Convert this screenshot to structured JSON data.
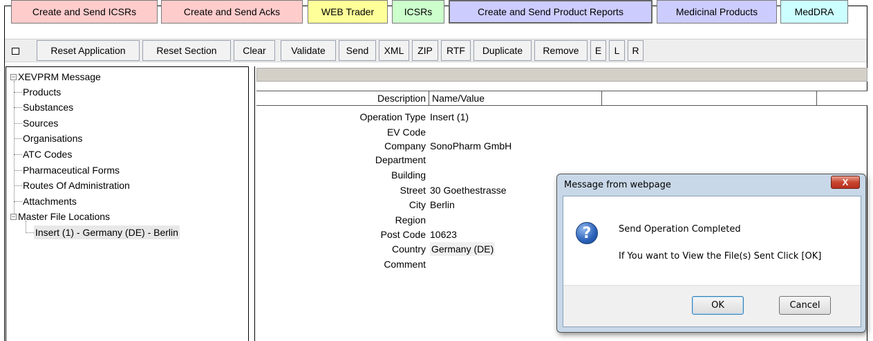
{
  "tabs": [
    {
      "label": "Create and Send ICSRs",
      "color": "#ffcccc"
    },
    {
      "label": "Create and Send Acks",
      "color": "#ffcccc"
    },
    {
      "label": "WEB Trader",
      "color": "#ffff99"
    },
    {
      "label": "ICSRs",
      "color": "#ccffcc"
    },
    {
      "label": "Create and Send Product Reports",
      "color": "#ccccff"
    },
    {
      "label": "Medicinal Products",
      "color": "#ccccff"
    },
    {
      "label": "MedDRA",
      "color": "#ccffff"
    }
  ],
  "toolbar": {
    "reset_application": "Reset Application",
    "reset_section": "Reset Section",
    "clear": "Clear",
    "validate": "Validate",
    "send": "Send",
    "xml": "XML",
    "zip": "ZIP",
    "rtf": "RTF",
    "duplicate": "Duplicate",
    "remove": "Remove",
    "e": "E",
    "l": "L",
    "r": "R"
  },
  "tree": {
    "root": "XEVPRM Message",
    "items": [
      "Products",
      "Substances",
      "Sources",
      "Organisations",
      "ATC Codes",
      "Pharmaceutical Forms",
      "Routes Of Administration",
      "Attachments"
    ],
    "master": "Master File Locations",
    "child": "Insert (1) - Germany (DE) - Berlin"
  },
  "grid": {
    "headers": [
      "Description",
      "Name/Value"
    ],
    "rows": [
      {
        "label": "Operation Type",
        "value": "Insert (1)"
      },
      {
        "label": "EV Code",
        "value": ""
      },
      {
        "label": "Company",
        "value": "SonoPharm GmbH"
      },
      {
        "label": "Department",
        "value": ""
      },
      {
        "label": "Building",
        "value": ""
      },
      {
        "label": "Street",
        "value": "30 Goethestrasse"
      },
      {
        "label": "City",
        "value": "Berlin"
      },
      {
        "label": "Region",
        "value": ""
      },
      {
        "label": "Post Code",
        "value": "10623"
      },
      {
        "label": "Country",
        "value": "Germany (DE)"
      },
      {
        "label": "Comment",
        "value": ""
      }
    ]
  },
  "dialog": {
    "title": "Message from webpage",
    "close": "X",
    "message": "Send Operation Completed",
    "detail": "If You want to View the File(s) Sent Click [OK]",
    "ok": "OK",
    "cancel": "Cancel"
  }
}
